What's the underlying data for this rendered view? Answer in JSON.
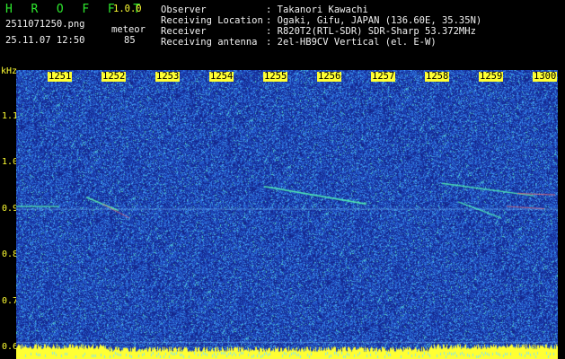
{
  "app": {
    "title": "H R O F F T",
    "version": "1.0.0",
    "filename": "2511071250.png",
    "datetime": "25.11.07 12:50",
    "mode_label": "meteor",
    "mode_value": "85"
  },
  "info": {
    "observer_label": "Observer",
    "observer_value": ": Takanori Kawachi",
    "location_label": "Receiving Location",
    "location_value": ": Ogaki, Gifu, JAPAN (136.60E, 35.35N)",
    "receiver_label": "Receiver",
    "receiver_value": ": R820T2(RTL-SDR) SDR-Sharp 53.372MHz",
    "antenna_label": "Receiving antenna",
    "antenna_value": ": 2el-HB9CV Vertical (el. E-W)"
  },
  "spectrogram": {
    "y_unit": "kHz",
    "y_ticks": [
      "1.1",
      "1.0",
      "0.9",
      "0.8",
      "0.7",
      "0.6"
    ],
    "y_tick_values": [
      1.1,
      1.0,
      0.9,
      0.8,
      0.7,
      0.6
    ],
    "y_range": [
      0.575,
      1.2
    ],
    "x_ticks": [
      "1251",
      "1252",
      "1253",
      "1254",
      "1255",
      "1256",
      "1257",
      "1258",
      "1259",
      "1300"
    ],
    "x_tick_minutes": [
      1,
      2,
      3,
      4,
      5,
      6,
      7,
      8,
      9,
      10
    ],
    "x_range_minutes": [
      0,
      10
    ],
    "colors": {
      "background": "#12237a",
      "noise_low": "#1a3aa8",
      "noise_high": "#3fa0ff",
      "signal": "#2ee8a0",
      "label_bg": "#ffff33",
      "baseline": "#ffff33"
    }
  }
}
